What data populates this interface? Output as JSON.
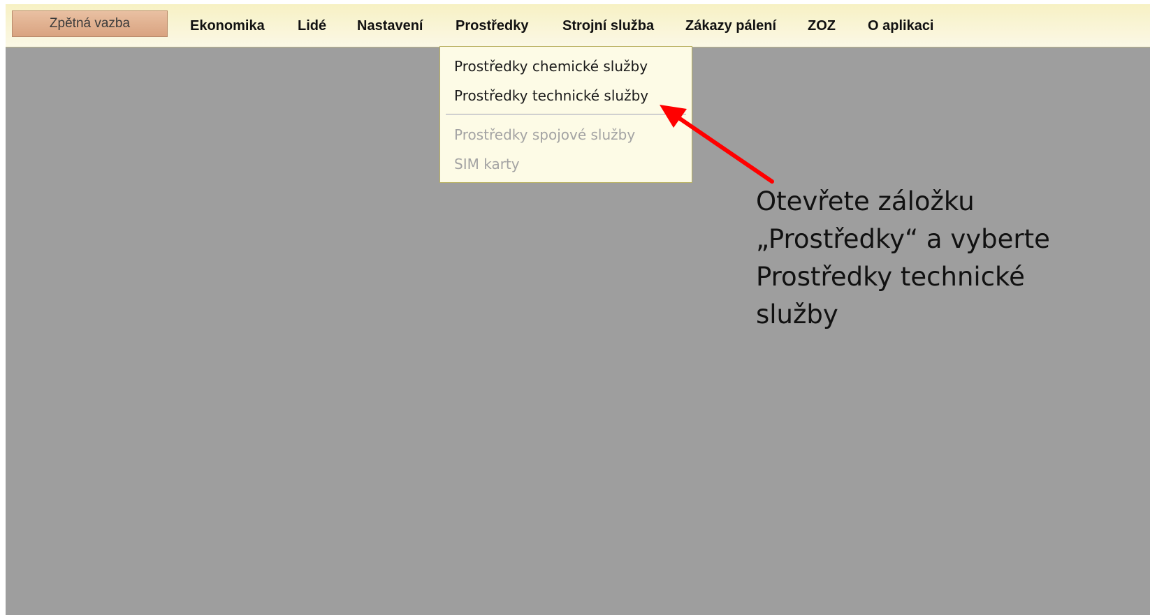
{
  "menubar": {
    "feedback_label": "Zpětná vazba",
    "items": [
      {
        "label": "Ekonomika"
      },
      {
        "label": "Lidé"
      },
      {
        "label": "Nastavení"
      },
      {
        "label": "Prostředky"
      },
      {
        "label": "Strojní služba"
      },
      {
        "label": "Zákazy pálení"
      },
      {
        "label": "ZOZ"
      },
      {
        "label": "O aplikaci"
      }
    ]
  },
  "dropdown": {
    "items": [
      {
        "label": "Prostředky chemické služby",
        "enabled": true
      },
      {
        "label": "Prostředky technické služby",
        "enabled": true
      },
      {
        "label": "Prostředky spojové služby",
        "enabled": false
      },
      {
        "label": "SIM karty",
        "enabled": false
      }
    ]
  },
  "annotation": {
    "lines": [
      "Otevřete záložku",
      "„Prostředky“ a vyberte",
      "Prostředky technické",
      "služby"
    ],
    "arrow_color": "#ff0000"
  },
  "colors": {
    "workspace": "#9e9e9e",
    "menubar": "#f7f1c4",
    "feedback_button": "#e0b090",
    "dropdown": "#fdfbe6"
  }
}
